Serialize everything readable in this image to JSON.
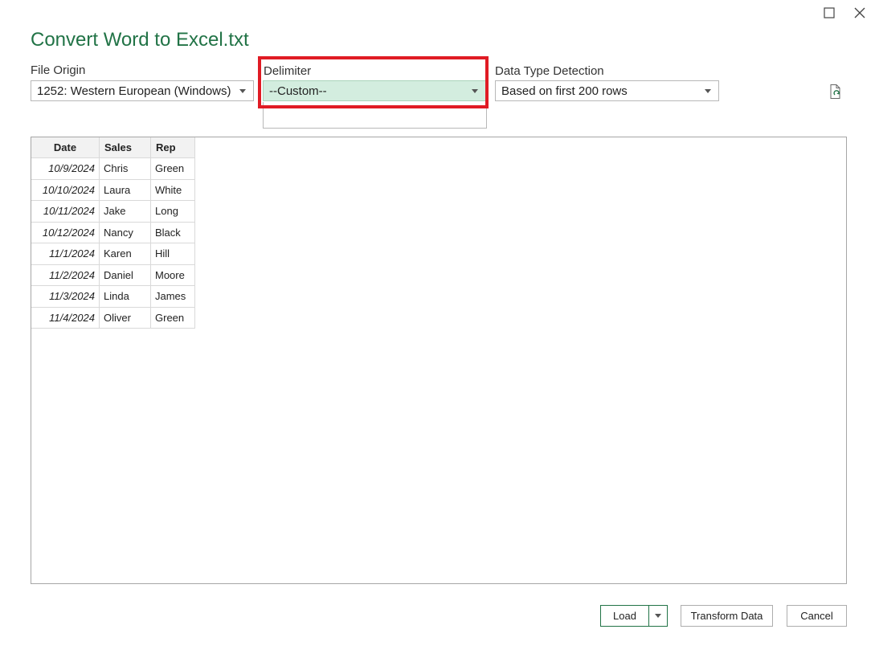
{
  "window": {
    "title": "Convert Word to Excel.txt"
  },
  "file_origin": {
    "label": "File Origin",
    "value": "1252: Western European (Windows)"
  },
  "delimiter": {
    "label": "Delimiter",
    "value": "--Custom--",
    "highlight_color": "#e01b24",
    "selected_bg": "#d3eddf"
  },
  "data_type_detection": {
    "label": "Data Type Detection",
    "value": "Based on first 200 rows"
  },
  "preview": {
    "columns": [
      "Date",
      "Sales",
      "Rep"
    ],
    "rows": [
      [
        "10/9/2024",
        "Chris",
        "Green"
      ],
      [
        "10/10/2024",
        "Laura",
        "White"
      ],
      [
        "10/11/2024",
        "Jake",
        "Long"
      ],
      [
        "10/12/2024",
        "Nancy",
        "Black"
      ],
      [
        "11/1/2024",
        "Karen",
        "Hill"
      ],
      [
        "11/2/2024",
        "Daniel",
        "Moore"
      ],
      [
        "11/3/2024",
        "Linda",
        "James"
      ],
      [
        "11/4/2024",
        "Oliver",
        "Green"
      ]
    ]
  },
  "buttons": {
    "load": "Load",
    "transform": "Transform Data",
    "cancel": "Cancel"
  },
  "colors": {
    "accent": "#217346"
  }
}
